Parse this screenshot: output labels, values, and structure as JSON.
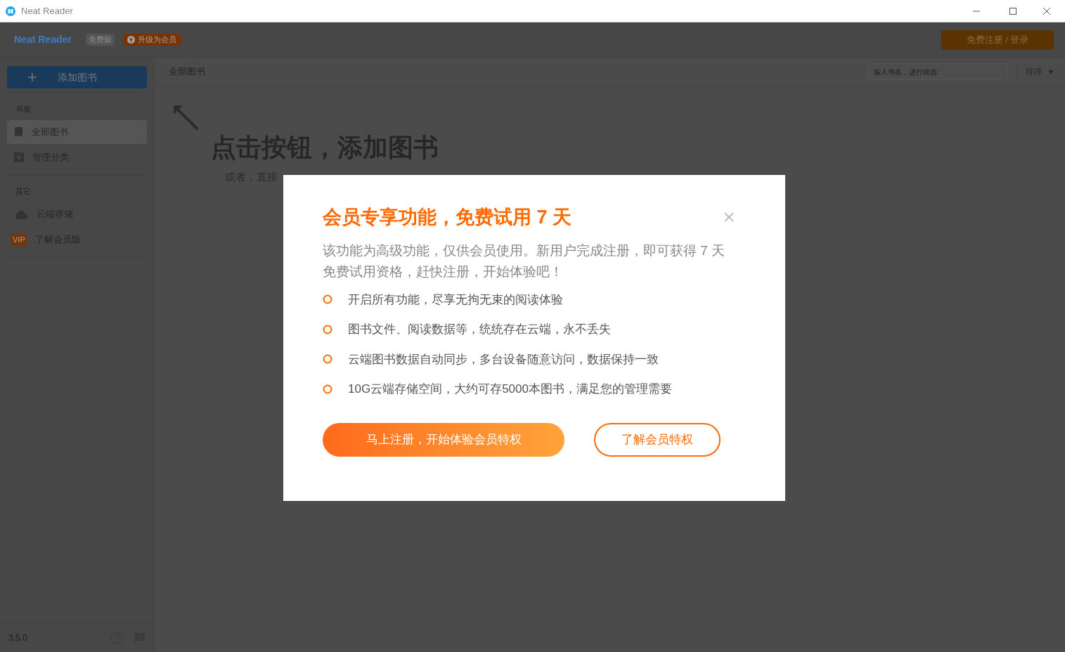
{
  "window": {
    "title": "Neat Reader"
  },
  "header": {
    "brand": "Neat Reader",
    "edition_badge": "免费版",
    "upgrade_button": "升级为会员",
    "login_button": "免费注册 / 登录"
  },
  "sidebar": {
    "add_button": "添加图书",
    "sections": [
      {
        "title": "书架",
        "items": [
          {
            "kind": "book",
            "label": "全部图书",
            "selected": true
          },
          {
            "kind": "plus",
            "label": "管理分类",
            "selected": false
          }
        ]
      },
      {
        "title": "其它",
        "items": [
          {
            "kind": "cloud",
            "label": "云端存储",
            "selected": false
          },
          {
            "kind": "vip",
            "badge": "VIP",
            "label": "了解会员版",
            "selected": false
          }
        ]
      }
    ],
    "version": "3.5.0"
  },
  "toolbar": {
    "title": "全部图书",
    "search": {
      "placeholder": "输入书名，进行筛选"
    },
    "sort": "排序"
  },
  "empty_state": {
    "heading": "点击按钮，添加图书",
    "hint": "或者，直接"
  },
  "dialog": {
    "title": "会员专享功能，免费试用 7 天",
    "description": "该功能为高级功能，仅供会员使用。新用户完成注册，即可获得 7 天免费试用资格，赶快注册，开始体验吧！",
    "features": [
      "开启所有功能，尽享无拘无束的阅读体验",
      "图书文件、阅读数据等，统统存在云端，永不丢失",
      "云端图书数据自动同步，多台设备随意访问，数据保持一致",
      "10G云端存储空间，大约可存5000本图书，满足您的管理需要"
    ],
    "primary_button": "马上注册，开始体验会员特权",
    "secondary_button": "了解会员特权"
  }
}
